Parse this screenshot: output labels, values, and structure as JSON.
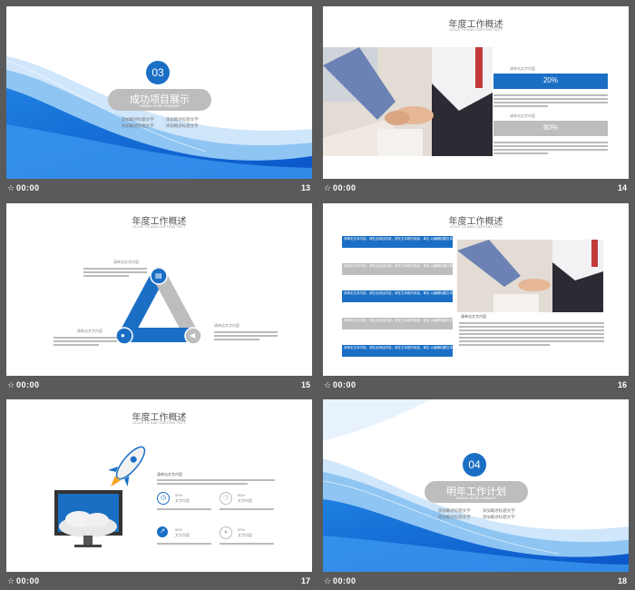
{
  "slides": [
    {
      "number": "13",
      "time": "00:00",
      "badge": "03",
      "title": "成功项目展示",
      "subtitle": "ANNUAL WORK SUMMARY",
      "bullets": [
        "· 添加概述标题文字",
        "· 添加概述标题文字",
        "· 添加概述标题文字",
        "· 添加概述标题文字"
      ]
    },
    {
      "number": "14",
      "time": "00:00",
      "title": "年度工作概述",
      "subtitle": "CLICK TO ADD CAPTION TEXT",
      "label1": "请单击文字内容",
      "value1": "20%",
      "label2": "请单击文字内容",
      "value2": "80%"
    },
    {
      "number": "15",
      "time": "00:00",
      "title": "年度工作概述",
      "subtitle": "CLICK TO ADD CAPTION TEXT",
      "labels": [
        "请单击文字内容",
        "请单击文字内容",
        "请单击文字内容"
      ]
    },
    {
      "number": "16",
      "time": "00:00",
      "title": "年度工作概述",
      "subtitle": "CLICK TO ADD CAPTION TEXT",
      "rows": [
        "请单击文本内容，请在此添加内容，请在文本框内添加，单击 以编辑标题文本",
        "请单击文本内容，请在此添加内容，请在文本框内添加，单击 以编辑标题文本",
        "请单击文本内容，请在此添加内容，请在文本框内添加，单击 以编辑标题文本",
        "请单击文本内容，请在此添加内容，请在文本框内添加，单击 以编辑标题文本",
        "请单击文本内容，请在此添加内容，请在文本框内添加，单击 以编辑标题文本"
      ],
      "caption": "请单击文字内容"
    },
    {
      "number": "17",
      "time": "00:00",
      "title": "年度工作概述",
      "subtitle": "CLICK TO ADD CAPTION TEXT",
      "head": "请单击文字内容",
      "items": [
        {
          "pct": "50%",
          "label": "文字内容"
        },
        {
          "pct": "50%",
          "label": "文字内容"
        },
        {
          "pct": "50%",
          "label": "文字内容"
        },
        {
          "pct": "50%",
          "label": "文字内容"
        }
      ]
    },
    {
      "number": "18",
      "time": "00:00",
      "badge": "04",
      "title": "明年工作计划",
      "subtitle": "ANNUAL WORK SUMMARY",
      "bullets": [
        "· 添加概述标题文字",
        "· 添加概述标题文字",
        "· 添加概述标题文字",
        "· 添加概述标题文字"
      ]
    }
  ],
  "colors": {
    "accent": "#1a6fc4",
    "grey": "#bdbdbd",
    "background": "#5a5a5a"
  }
}
